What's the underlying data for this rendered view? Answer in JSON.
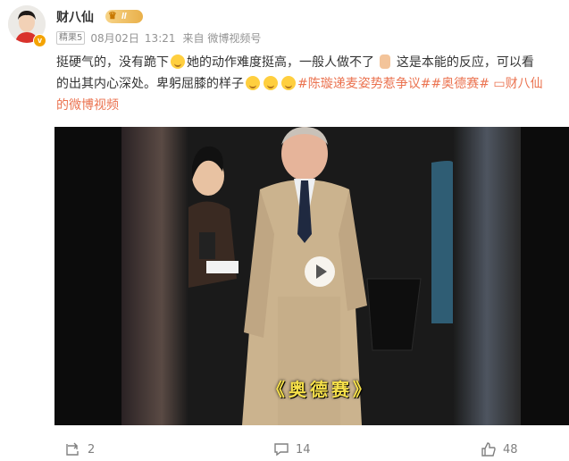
{
  "post": {
    "username": "财八仙",
    "vip_level": "II",
    "tag": "精果5",
    "date": "08月02日",
    "time": "13:21",
    "source": "来自 微博视频号",
    "text_line1_a": "挺硬气的，没有跪下",
    "text_line1_b": "她的动作难度挺高，一般人做不了",
    "text_line1_c": "这是本能的反应，可以看",
    "text_line2_a": "的出其内心深处。卑躬屈膝的样子",
    "hashtag1": "#陈璇递麦姿势惹争议#",
    "hashtag2": "#奥德赛#",
    "video_link_icon": "video-icon",
    "video_link_a": "财八仙",
    "video_link_b": "的微博视频",
    "video_caption": "《奥德赛》"
  },
  "actions": {
    "repost_count": "2",
    "comment_count": "14",
    "like_count": "48"
  },
  "colors": {
    "link": "#eb7350",
    "vip_gold": "#e9b04a",
    "verified": "#f4a300"
  }
}
